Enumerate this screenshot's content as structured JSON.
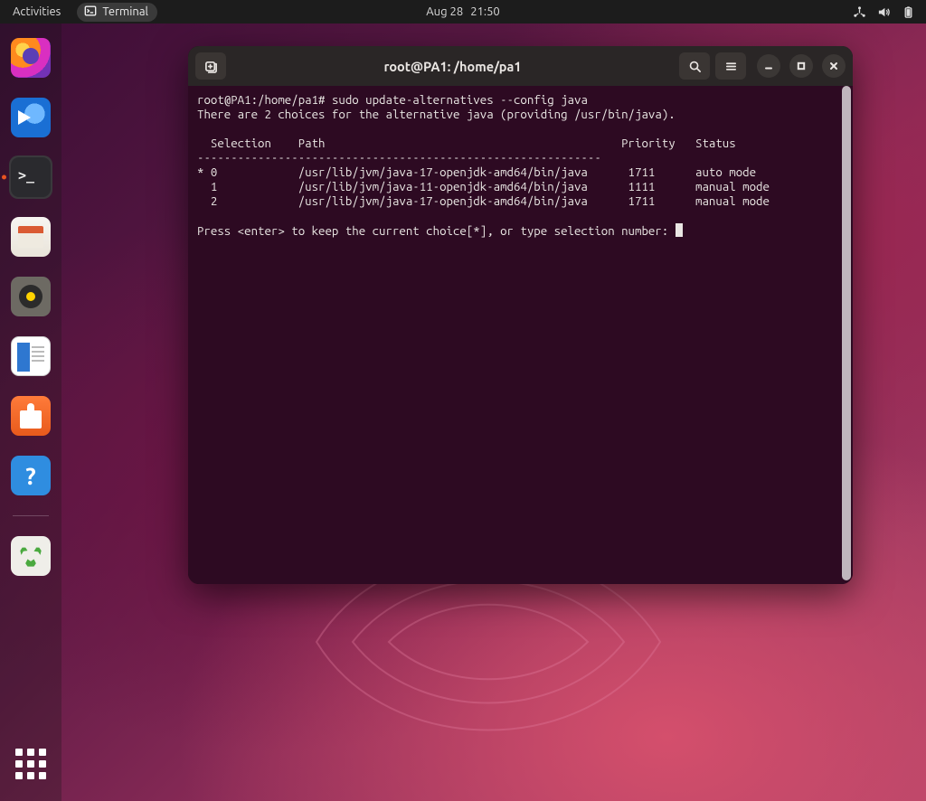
{
  "topbar": {
    "activities": "Activities",
    "app_label": "Terminal",
    "clock_date": "Aug 28",
    "clock_time": "21:50"
  },
  "dock": {
    "items": [
      {
        "name": "firefox",
        "title": "Firefox"
      },
      {
        "name": "thunderbird",
        "title": "Thunderbird"
      },
      {
        "name": "terminal",
        "title": "Terminal",
        "running": true,
        "active": true
      },
      {
        "name": "files",
        "title": "Files"
      },
      {
        "name": "rhythmbox",
        "title": "Rhythmbox"
      },
      {
        "name": "libreoffice",
        "title": "LibreOffice Writer"
      },
      {
        "name": "software",
        "title": "Ubuntu Software"
      },
      {
        "name": "help",
        "title": "Help"
      },
      {
        "name": "trash",
        "title": "Trash"
      }
    ],
    "show_apps_title": "Show Applications"
  },
  "window": {
    "title": "root@PA1: /home/pa1",
    "prompt": "root@PA1:/home/pa1# ",
    "command": "sudo update-alternatives --config java",
    "intro_line": "There are 2 choices for the alternative java (providing /usr/bin/java).",
    "header": "  Selection    Path                                            Priority   Status",
    "divider": "------------------------------------------------------------",
    "rows_text": [
      "* 0            /usr/lib/jvm/java-17-openjdk-amd64/bin/java      1711      auto mode",
      "  1            /usr/lib/jvm/java-11-openjdk-amd64/bin/java      1111      manual mode",
      "  2            /usr/lib/jvm/java-17-openjdk-amd64/bin/java      1711      manual mode"
    ],
    "alternatives": [
      {
        "mark": "*",
        "selection": 0,
        "path": "/usr/lib/jvm/java-17-openjdk-amd64/bin/java",
        "priority": 1711,
        "status": "auto mode"
      },
      {
        "mark": " ",
        "selection": 1,
        "path": "/usr/lib/jvm/java-11-openjdk-amd64/bin/java",
        "priority": 1111,
        "status": "manual mode"
      },
      {
        "mark": " ",
        "selection": 2,
        "path": "/usr/lib/jvm/java-17-openjdk-amd64/bin/java",
        "priority": 1711,
        "status": "manual mode"
      }
    ],
    "press_enter": "Press <enter> to keep the current choice[*], or type selection number: "
  }
}
